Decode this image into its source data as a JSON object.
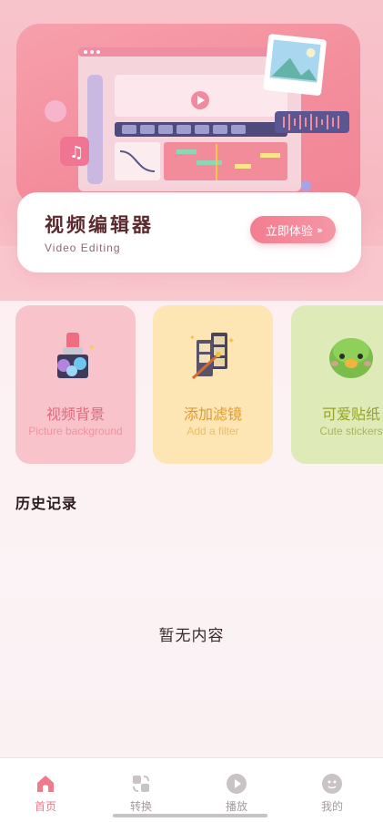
{
  "banner": {
    "title": "视频编辑器",
    "subtitle": "Video Editing",
    "cta_label": "立即体验"
  },
  "features": [
    {
      "title": "视频背景",
      "subtitle": "Picture background",
      "icon": "paint-brush-icon"
    },
    {
      "title": "添加滤镜",
      "subtitle": "Add a filter",
      "icon": "film-strip-icon"
    },
    {
      "title": "可爱贴纸",
      "subtitle": "Cute stickers",
      "icon": "bird-sticker-icon"
    }
  ],
  "history": {
    "title": "历史记录",
    "empty_text": "暂无内容"
  },
  "tabs": [
    {
      "label": "首页",
      "icon": "home-icon",
      "active": true
    },
    {
      "label": "转换",
      "icon": "convert-icon",
      "active": false
    },
    {
      "label": "播放",
      "icon": "play-icon",
      "active": false
    },
    {
      "label": "我的",
      "icon": "profile-icon",
      "active": false
    }
  ],
  "colors": {
    "accent": "#f07a8c",
    "inactive": "#a39b9c"
  }
}
